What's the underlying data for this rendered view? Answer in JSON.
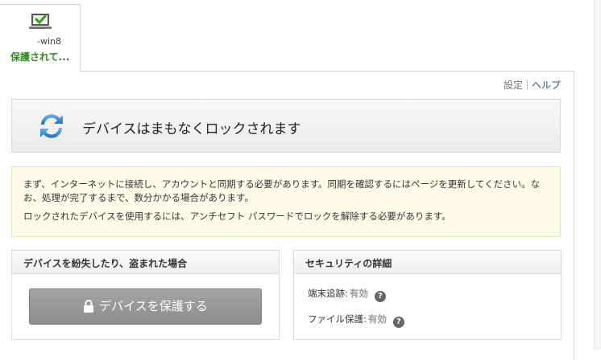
{
  "device": {
    "name": "-win8",
    "status": "保護されて..."
  },
  "toplinks": {
    "settings": "設定",
    "help": "ヘルプ"
  },
  "banner": {
    "title": "デバイスはまもなくロックされます"
  },
  "notice": {
    "line1": "まず、インターネットに接続し、アカウントと同期する必要があります。同期を確認するにはページを更新してください。なお、処理が完了するまで、数分かかる場合があります。",
    "line2": "ロックされたデバイスを使用するには、アンチセフト パスワードでロックを解除する必要があります。"
  },
  "lost_panel": {
    "header": "デバイスを紛失したり、盗まれた場合",
    "button": "デバイスを保護する"
  },
  "security_panel": {
    "header": "セキュリティの詳細",
    "rows": [
      {
        "label": "端末追跡:",
        "value": "有効"
      },
      {
        "label": "ファイル保護:",
        "value": "有効"
      }
    ]
  },
  "colors": {
    "status_green": "#2f8a1c",
    "help_link": "#1a5d8a",
    "button_gray": "#9a9a9a"
  }
}
